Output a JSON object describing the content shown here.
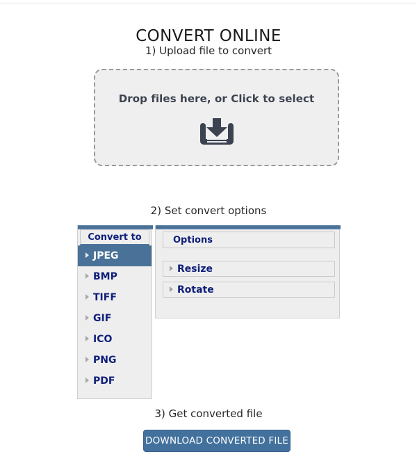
{
  "page": {
    "title": "CONVERT ONLINE"
  },
  "steps": {
    "step1": "1) Upload file to convert",
    "step2": "2) Set convert options",
    "step3": "3) Get converted file"
  },
  "dropzone": {
    "text": "Drop files here, or Click to select",
    "icon": "download-tray-icon"
  },
  "convert_panel": {
    "header": "Convert to",
    "formats": [
      {
        "label": "JPEG",
        "selected": true
      },
      {
        "label": "BMP",
        "selected": false
      },
      {
        "label": "TIFF",
        "selected": false
      },
      {
        "label": "GIF",
        "selected": false
      },
      {
        "label": "ICO",
        "selected": false
      },
      {
        "label": "PNG",
        "selected": false
      },
      {
        "label": "PDF",
        "selected": false
      }
    ]
  },
  "options_panel": {
    "header": "Options",
    "accordion": [
      {
        "label": "Resize",
        "expanded": false
      },
      {
        "label": "Rotate",
        "expanded": false
      }
    ]
  },
  "download": {
    "label": "DOWNLOAD CONVERTED FILE"
  },
  "colors": {
    "accent": "#4a7298",
    "button": "#43719d",
    "link_text": "#10207a",
    "dropzone_bg": "#efefef",
    "dropzone_border": "#9a9a9a",
    "panel_bg": "#eeeeee",
    "icon": "#3b4250"
  }
}
